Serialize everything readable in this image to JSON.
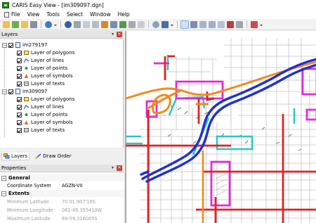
{
  "window": {
    "title": "CARIS Easy View - [im309097.dgn]"
  },
  "menu": [
    "File",
    "View",
    "Tools",
    "Select",
    "Window",
    "Help"
  ],
  "layers_panel": {
    "title": "Layers",
    "groups": [
      {
        "name": "im279197",
        "children": [
          "Layer of polygons",
          "Layer of lines",
          "Layer of points",
          "Layer of symbols",
          "Layer of texts"
        ]
      },
      {
        "name": "im309097",
        "children": [
          "Layer of polygons",
          "Layer of lines",
          "Layer of points",
          "Layer of symbols",
          "Layer of texts"
        ]
      }
    ]
  },
  "bottom_tabs": [
    "Layers",
    "Draw Order"
  ],
  "properties_panel": {
    "title": "Properties",
    "sections": [
      {
        "name": "General",
        "rows": [
          {
            "key": "Coordinate System",
            "value": "AGZN-VII"
          }
        ]
      },
      {
        "name": "Extents",
        "rows": [
          {
            "key": "Minimum Latitude",
            "value": "70 01.907'16S"
          },
          {
            "key": "Minimum Longitude",
            "value": "081-49.355410W"
          },
          {
            "key": "Maximum Latitude",
            "value": "69-59.316005S"
          }
        ]
      }
    ]
  },
  "colors": {
    "accent": "#cfe3f7",
    "close": "#c9403a"
  },
  "icons": [
    "app-icon",
    "pin-icon",
    "close-icon",
    "layers-tab-icon",
    "draw-order-tab-icon"
  ]
}
